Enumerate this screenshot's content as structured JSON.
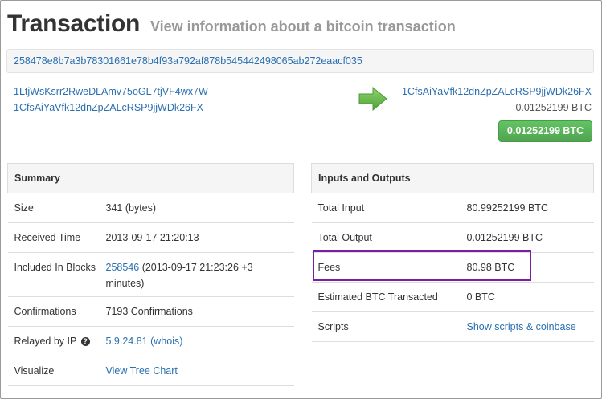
{
  "header": {
    "title": "Transaction",
    "subtitle": "View information about a bitcoin transaction"
  },
  "tx_hash": "258478e8b7a3b78301661e78b4f93a792af878b545442498065ab272eaacf035",
  "inputs": [
    "1LtjWsKsrr2RweDLAmv75oGL7tjVF4wx7W",
    "1CfsAiYaVfk12dnZpZALcRSP9jjWDk26FX"
  ],
  "outputs": [
    {
      "address": "1CfsAiYaVfk12dnZpZALcRSP9jjWDk26FX",
      "amount": "0.01252199 BTC"
    }
  ],
  "total_button": "0.01252199 BTC",
  "colors": {
    "link": "#2a6fb0",
    "button_green": "#5bb75b",
    "highlight_purple": "#7a1fa2",
    "arrow_green": "#6cc04a"
  },
  "summary": {
    "heading": "Summary",
    "size_label": "Size",
    "size_value": "341 (bytes)",
    "received_label": "Received Time",
    "received_value": "2013-09-17 21:20:13",
    "included_label": "Included In Blocks",
    "included_block": "258546",
    "included_rest": " (2013-09-17 21:23:26 +3 minutes)",
    "confirmations_label": "Confirmations",
    "confirmations_value": "7193 Confirmations",
    "relayed_label": "Relayed by IP",
    "relayed_help": "?",
    "relayed_ip": "5.9.24.81 (whois)",
    "visualize_label": "Visualize",
    "visualize_value": "View Tree Chart"
  },
  "io": {
    "heading": "Inputs and Outputs",
    "total_input_label": "Total Input",
    "total_input_value": "80.99252199 BTC",
    "total_output_label": "Total Output",
    "total_output_value": "0.01252199 BTC",
    "fees_label": "Fees",
    "fees_value": "80.98 BTC",
    "estimated_label": "Estimated BTC Transacted",
    "estimated_value": "0 BTC",
    "scripts_label": "Scripts",
    "scripts_value": "Show scripts & coinbase"
  }
}
